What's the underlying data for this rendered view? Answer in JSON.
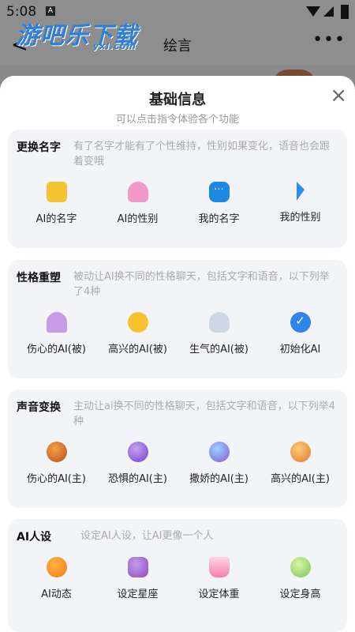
{
  "status": {
    "time": "5:08",
    "notif": "A"
  },
  "watermark": {
    "text": "游吧乐下载",
    "sub": "yxl.com"
  },
  "appbar": {
    "back": "<",
    "title": "绘言",
    "more": "•••"
  },
  "sheet": {
    "title": "基础信息",
    "subtitle": "可以点击指令体验各个功能",
    "close": "×"
  },
  "sections": [
    {
      "title": "更换名字",
      "desc": "有了名字才能有了个性维持，性别如果变化，语音也会跟着变哦",
      "items": [
        {
          "icon": "chat-bubble-icon",
          "label": "AI的名字"
        },
        {
          "icon": "heart-icon",
          "label": "AI的性别"
        },
        {
          "icon": "message-icon",
          "label": "我的名字"
        },
        {
          "icon": "cursor-icon",
          "label": "我的性别"
        }
      ]
    },
    {
      "title": "性格重塑",
      "desc": "被动让AI换不同的性格聊天，包括文字和语音，以下列举了4种",
      "items": [
        {
          "icon": "umbrella-icon",
          "label": "伤心的AI(被)"
        },
        {
          "icon": "sunflower-icon",
          "label": "高兴的AI(被)"
        },
        {
          "icon": "snow-cloud-icon",
          "label": "生气的AI(被)"
        },
        {
          "icon": "check-icon",
          "label": "初始化AI"
        }
      ]
    },
    {
      "title": "声音变换",
      "desc": "主动让ai换不同的性格聊天，包括文字和语音，以下列举4种",
      "items": [
        {
          "icon": "planet-orange-icon",
          "label": "伤心的AI(主)"
        },
        {
          "icon": "planet-purple-icon",
          "label": "恐惧的AI(主)"
        },
        {
          "icon": "planet-blue-icon",
          "label": "撒娇的AI(主)"
        },
        {
          "icon": "planet-ring-icon",
          "label": "高兴的AI(主)"
        }
      ]
    },
    {
      "title": "AI人设",
      "desc": "设定AI人设，让AI更像一个人",
      "items": [
        {
          "icon": "orange-icon",
          "label": "AI动态"
        },
        {
          "icon": "grape-icon",
          "label": "设定星座"
        },
        {
          "icon": "drink-icon",
          "label": "设定体重"
        },
        {
          "icon": "coconut-icon",
          "label": "设定身高"
        }
      ]
    }
  ]
}
